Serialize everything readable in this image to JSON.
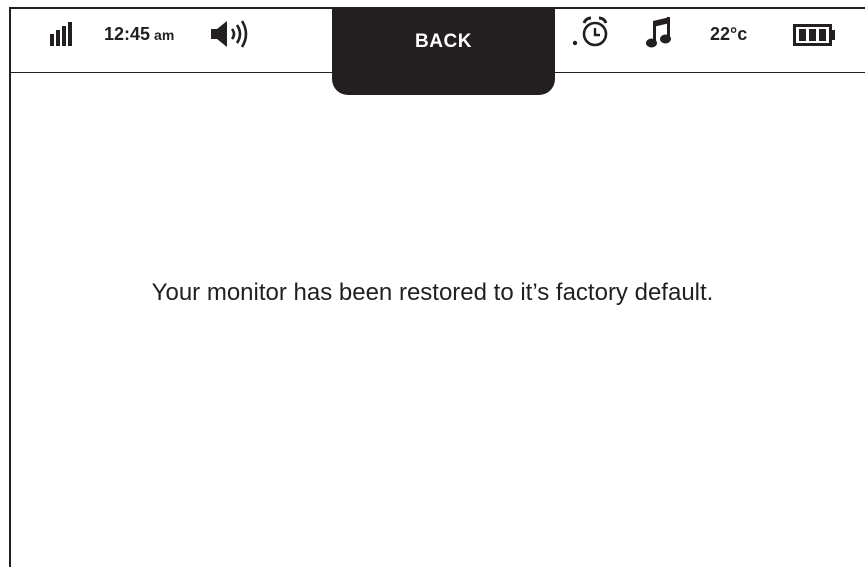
{
  "status_bar": {
    "time": "12:45",
    "ampm": "am",
    "temperature": "22°c",
    "icons": {
      "signal": "signal-strength-icon",
      "volume": "speaker-volume-icon",
      "alarm": "alarm-clock-icon",
      "music": "music-note-icon",
      "battery": "battery-full-icon"
    }
  },
  "back_tab": {
    "label": "BACK"
  },
  "main": {
    "message": "Your monitor has been restored to it’s factory default."
  },
  "colors": {
    "foreground": "#231f20",
    "background": "#ffffff"
  }
}
